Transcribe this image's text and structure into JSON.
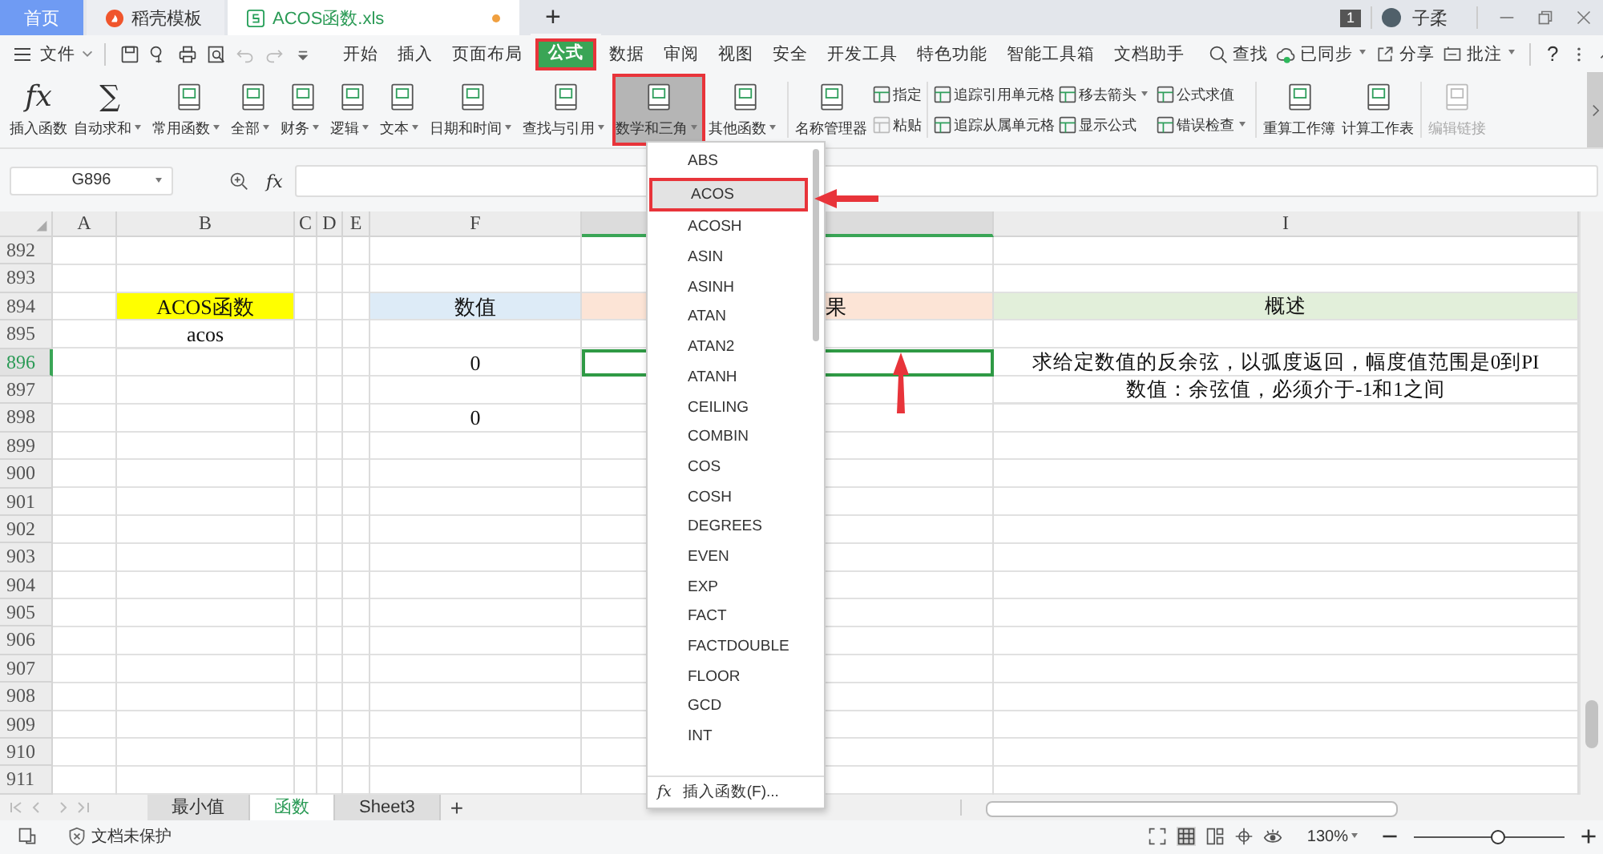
{
  "tabs": [
    {
      "label": "首页",
      "kind": "home",
      "selected": false
    },
    {
      "label": "稻壳模板",
      "kind": "docer",
      "selected": false
    },
    {
      "label": "ACOS函数.xls",
      "kind": "sheet",
      "selected": true,
      "unsaved": true
    }
  ],
  "new_tab": "+",
  "account": {
    "badge": "1",
    "name": "子柔"
  },
  "menu": {
    "file": "文件",
    "items": [
      {
        "label": "开始",
        "selected": false,
        "annotated": false
      },
      {
        "label": "插入",
        "selected": false,
        "annotated": false
      },
      {
        "label": "页面布局",
        "selected": false,
        "annotated": false
      },
      {
        "label": "公式",
        "selected": true,
        "annotated": true
      },
      {
        "label": "数据",
        "selected": false,
        "annotated": false
      },
      {
        "label": "审阅",
        "selected": false,
        "annotated": false
      },
      {
        "label": "视图",
        "selected": false,
        "annotated": false
      },
      {
        "label": "安全",
        "selected": false,
        "annotated": false
      },
      {
        "label": "开发工具",
        "selected": false,
        "annotated": false
      },
      {
        "label": "特色功能",
        "selected": false,
        "annotated": false
      },
      {
        "label": "智能工具箱",
        "selected": false,
        "annotated": false
      },
      {
        "label": "文档助手",
        "selected": false,
        "annotated": false
      }
    ],
    "search": "查找",
    "sync": "已同步",
    "share": "分享",
    "comment": "批注",
    "help": "?"
  },
  "ribbon": [
    {
      "kind": "big",
      "label": "插入函数",
      "glyph": "fx",
      "dropdown": false,
      "selected": false,
      "annotated": false,
      "disabled": false
    },
    {
      "kind": "big",
      "label": "自动求和",
      "glyph": "∑",
      "dropdown": true,
      "selected": false,
      "annotated": false,
      "disabled": false
    },
    {
      "kind": "big",
      "label": "常用函数",
      "dropdown": true,
      "selected": false,
      "annotated": false,
      "disabled": false
    },
    {
      "kind": "big",
      "label": "全部",
      "dropdown": true,
      "selected": false,
      "annotated": false,
      "disabled": false
    },
    {
      "kind": "big",
      "label": "财务",
      "dropdown": true,
      "selected": false,
      "annotated": false,
      "disabled": false
    },
    {
      "kind": "big",
      "label": "逻辑",
      "dropdown": true,
      "selected": false,
      "annotated": false,
      "disabled": false
    },
    {
      "kind": "big",
      "label": "文本",
      "dropdown": true,
      "selected": false,
      "annotated": false,
      "disabled": false
    },
    {
      "kind": "big",
      "label": "日期和时间",
      "dropdown": true,
      "selected": false,
      "annotated": false,
      "disabled": false
    },
    {
      "kind": "big",
      "label": "查找与引用",
      "dropdown": true,
      "selected": false,
      "annotated": false,
      "disabled": false
    },
    {
      "kind": "big",
      "label": "数学和三角",
      "dropdown": true,
      "selected": true,
      "annotated": true,
      "disabled": false
    },
    {
      "kind": "big",
      "label": "其他函数",
      "dropdown": true,
      "selected": false,
      "annotated": false,
      "disabled": false
    },
    {
      "kind": "divider"
    },
    {
      "kind": "big",
      "label": "名称管理器",
      "dropdown": false,
      "selected": false,
      "annotated": false,
      "disabled": false
    },
    {
      "kind": "pair",
      "rows": [
        {
          "label": "指定",
          "dropdown": false,
          "disabled": false
        },
        {
          "label": "粘贴",
          "dropdown": false,
          "disabled": true
        }
      ]
    },
    {
      "kind": "divider"
    },
    {
      "kind": "pair",
      "rows": [
        {
          "label": "追踪引用单元格",
          "dropdown": false,
          "disabled": false
        },
        {
          "label": "追踪从属单元格",
          "dropdown": false,
          "disabled": false
        }
      ]
    },
    {
      "kind": "pair",
      "rows": [
        {
          "label": "移去箭头",
          "dropdown": true,
          "disabled": false
        },
        {
          "label": "显示公式",
          "dropdown": false,
          "disabled": false
        }
      ]
    },
    {
      "kind": "pair",
      "rows": [
        {
          "label": "公式求值",
          "dropdown": false,
          "disabled": false
        },
        {
          "label": "错误检查",
          "dropdown": true,
          "disabled": false
        }
      ]
    },
    {
      "kind": "divider"
    },
    {
      "kind": "big",
      "label": "重算工作簿",
      "dropdown": false,
      "selected": false,
      "annotated": false,
      "disabled": false
    },
    {
      "kind": "big",
      "label": "计算工作表",
      "dropdown": false,
      "selected": false,
      "annotated": false,
      "disabled": false
    },
    {
      "kind": "divider"
    },
    {
      "kind": "big",
      "label": "编辑链接",
      "dropdown": false,
      "selected": false,
      "annotated": false,
      "disabled": true
    }
  ],
  "formula_bar": {
    "name_box": "G896",
    "fx": "fx"
  },
  "columns": [
    {
      "label": "A",
      "selected": false
    },
    {
      "label": "B",
      "selected": false
    },
    {
      "label": "C",
      "selected": false
    },
    {
      "label": "D",
      "selected": false
    },
    {
      "label": "E",
      "selected": false
    },
    {
      "label": "F",
      "selected": false
    },
    {
      "selected": true
    },
    {
      "label": "I",
      "selected": false
    }
  ],
  "rows": [
    {
      "number": "892",
      "selected": false
    },
    {
      "number": "893",
      "selected": false
    },
    {
      "number": "894",
      "selected": false,
      "cells": [
        {},
        {
          "text": "ACOS函数",
          "color": "#ffff00"
        },
        {},
        {},
        {},
        {
          "text": "数值",
          "color": "#ddebf7"
        },
        {
          "text": "果",
          "color": "#fce4d6"
        },
        {
          "text": "概述",
          "color": "#e2efda"
        }
      ]
    },
    {
      "number": "895",
      "selected": false,
      "cells": [
        {},
        {
          "text": "acos"
        },
        {},
        {},
        {},
        {},
        {},
        {}
      ]
    },
    {
      "number": "896",
      "selected": true,
      "cells": [
        {},
        {},
        {},
        {},
        {},
        {
          "text": "0"
        },
        {
          "selected": true
        },
        {
          "text": "求给定数值的反余弦，以弧度返回，幅度值范围是0到PI"
        }
      ]
    },
    {
      "number": "897",
      "selected": false,
      "cells": [
        {},
        {},
        {},
        {},
        {},
        {},
        {},
        {
          "text": "数值：余弦值，必须介于-1和1之间"
        }
      ]
    },
    {
      "number": "898",
      "selected": false,
      "cells": [
        {},
        {},
        {},
        {},
        {},
        {
          "text": "0"
        },
        {},
        {}
      ]
    },
    {
      "number": "899",
      "selected": false
    },
    {
      "number": "900",
      "selected": false
    },
    {
      "number": "901",
      "selected": false
    },
    {
      "number": "902",
      "selected": false
    },
    {
      "number": "903",
      "selected": false
    },
    {
      "number": "904",
      "selected": false
    },
    {
      "number": "905",
      "selected": false
    },
    {
      "number": "906",
      "selected": false
    },
    {
      "number": "907",
      "selected": false
    },
    {
      "number": "908",
      "selected": false
    },
    {
      "number": "909",
      "selected": false
    },
    {
      "number": "910",
      "selected": false
    },
    {
      "number": "911",
      "selected": false
    }
  ],
  "function_menu": {
    "items": [
      {
        "label": "ABS",
        "selected": false,
        "annotated": false
      },
      {
        "label": "ACOS",
        "selected": true,
        "annotated": true
      },
      {
        "label": "ACOSH",
        "selected": false,
        "annotated": false
      },
      {
        "label": "ASIN",
        "selected": false,
        "annotated": false
      },
      {
        "label": "ASINH",
        "selected": false,
        "annotated": false
      },
      {
        "label": "ATAN",
        "selected": false,
        "annotated": false
      },
      {
        "label": "ATAN2",
        "selected": false,
        "annotated": false
      },
      {
        "label": "ATANH",
        "selected": false,
        "annotated": false
      },
      {
        "label": "CEILING",
        "selected": false,
        "annotated": false
      },
      {
        "label": "COMBIN",
        "selected": false,
        "annotated": false
      },
      {
        "label": "COS",
        "selected": false,
        "annotated": false
      },
      {
        "label": "COSH",
        "selected": false,
        "annotated": false
      },
      {
        "label": "DEGREES",
        "selected": false,
        "annotated": false
      },
      {
        "label": "EVEN",
        "selected": false,
        "annotated": false
      },
      {
        "label": "EXP",
        "selected": false,
        "annotated": false
      },
      {
        "label": "FACT",
        "selected": false,
        "annotated": false
      },
      {
        "label": "FACTDOUBLE",
        "selected": false,
        "annotated": false
      },
      {
        "label": "FLOOR",
        "selected": false,
        "annotated": false
      },
      {
        "label": "GCD",
        "selected": false,
        "annotated": false
      },
      {
        "label": "INT",
        "selected": false,
        "annotated": false
      }
    ],
    "footer_glyph": "fx",
    "footer": "插入函数(F)..."
  },
  "sheets": [
    {
      "label": "最小值",
      "selected": false
    },
    {
      "label": "函数",
      "selected": true
    },
    {
      "label": "Sheet3",
      "selected": false
    }
  ],
  "add_sheet": "+",
  "status": {
    "protection": "文档未保护",
    "zoom": "130%",
    "level": 0.56
  }
}
